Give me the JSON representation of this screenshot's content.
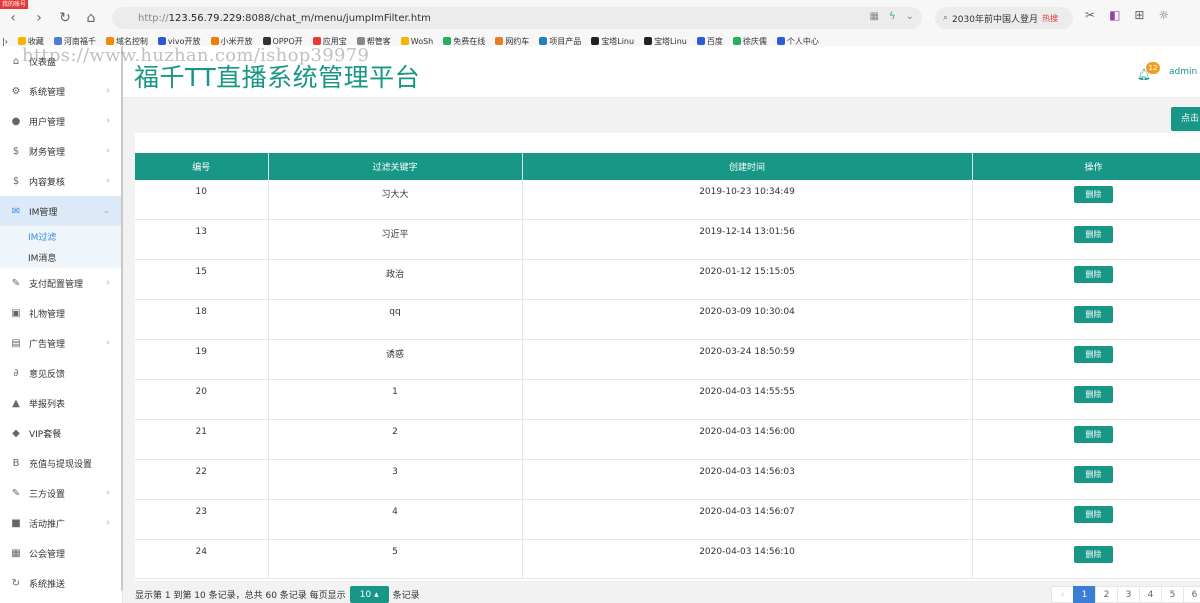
{
  "browser": {
    "badge": "我的账号",
    "protocol": "http://",
    "host": "123.56.79.229",
    "path": ":8088/chat_m/menu/jumpImFilter.htm",
    "search_text": "2030年前中国人登月",
    "search_hot": "热搜",
    "bookmarks": [
      {
        "label": "收藏",
        "color": "#f5b400"
      },
      {
        "label": "河南福千",
        "color": "#4a7fd0"
      },
      {
        "label": "域名控制",
        "color": "#f08c00"
      },
      {
        "label": "vivo开放",
        "color": "#2a5bd7"
      },
      {
        "label": "小米开放",
        "color": "#f57c00"
      },
      {
        "label": "OPPO开",
        "color": "#333333"
      },
      {
        "label": "应用宝",
        "color": "#e53935"
      },
      {
        "label": "帮管客",
        "color": "#888888"
      },
      {
        "label": "WoSh",
        "color": "#f5b400"
      },
      {
        "label": "免费在线",
        "color": "#27ae60"
      },
      {
        "label": "网约车",
        "color": "#e67e22"
      },
      {
        "label": "项目产品",
        "color": "#2980b9"
      },
      {
        "label": "宝塔Linu",
        "color": "#222222"
      },
      {
        "label": "宝塔Linu",
        "color": "#222222"
      },
      {
        "label": "百度",
        "color": "#2c5bd7"
      },
      {
        "label": "徐庆儒",
        "color": "#27ae60"
      },
      {
        "label": "个人中心",
        "color": "#2c5bd7"
      }
    ]
  },
  "watermark": "https://www.huzhan.com/ishop39979",
  "header": {
    "title": "福千TT直播系统管理平台",
    "notification_count": "12",
    "user": "admin"
  },
  "sidebar": {
    "items": [
      {
        "label": "仪表盘",
        "icon": "home-icon",
        "glyph": "⌂",
        "arrow": false
      },
      {
        "label": "系统管理",
        "icon": "settings-icon",
        "glyph": "⚙",
        "arrow": true
      },
      {
        "label": "用户管理",
        "icon": "user-icon",
        "glyph": "●",
        "arrow": true
      },
      {
        "label": "财务管理",
        "icon": "dollar-icon",
        "glyph": "$",
        "arrow": true
      },
      {
        "label": "内容复核",
        "icon": "dollar-icon",
        "glyph": "$",
        "arrow": true
      },
      {
        "label": "IM管理",
        "icon": "mail-icon",
        "glyph": "✉",
        "arrow": true,
        "active": true,
        "children": [
          {
            "label": "IM过滤",
            "current": true
          },
          {
            "label": "IM消息"
          }
        ]
      },
      {
        "label": "支付配置管理",
        "icon": "wrench-icon",
        "glyph": "✎",
        "arrow": true
      },
      {
        "label": "礼物管理",
        "icon": "gift-icon",
        "glyph": "▣",
        "arrow": false
      },
      {
        "label": "广告管理",
        "icon": "ad-icon",
        "glyph": "▤",
        "arrow": true
      },
      {
        "label": "意见反馈",
        "icon": "paperclip-icon",
        "glyph": "∂",
        "arrow": false
      },
      {
        "label": "举报列表",
        "icon": "warning-icon",
        "glyph": "▲",
        "arrow": false
      },
      {
        "label": "VIP套餐",
        "icon": "diamond-icon",
        "glyph": "◆",
        "arrow": false
      },
      {
        "label": "充值与提现设置",
        "icon": "bitcoin-icon",
        "glyph": "B",
        "arrow": false
      },
      {
        "label": "三方设置",
        "icon": "wrench-icon",
        "glyph": "✎",
        "arrow": true
      },
      {
        "label": "活动推广",
        "icon": "briefcase-icon",
        "glyph": "■",
        "arrow": true
      },
      {
        "label": "公会管理",
        "icon": "group-icon",
        "glyph": "▦",
        "arrow": false
      },
      {
        "label": "系统推送",
        "icon": "refresh-icon",
        "glyph": "↻",
        "arrow": false
      }
    ]
  },
  "toolbar": {
    "action_label": "点击"
  },
  "table": {
    "columns": [
      "编号",
      "过滤关键字",
      "创建时间",
      "操作"
    ],
    "delete_label": "删除",
    "rows": [
      {
        "id": "10",
        "keyword": "习大大",
        "created": "2019-10-23 10:34:49"
      },
      {
        "id": "13",
        "keyword": "习近平",
        "created": "2019-12-14 13:01:56"
      },
      {
        "id": "15",
        "keyword": "政治",
        "created": "2020-01-12 15:15:05"
      },
      {
        "id": "18",
        "keyword": "qq",
        "created": "2020-03-09 10:30:04"
      },
      {
        "id": "19",
        "keyword": "诱惑",
        "created": "2020-03-24 18:50:59"
      },
      {
        "id": "20",
        "keyword": "1",
        "created": "2020-04-03 14:55:55"
      },
      {
        "id": "21",
        "keyword": "2",
        "created": "2020-04-03 14:56:00"
      },
      {
        "id": "22",
        "keyword": "3",
        "created": "2020-04-03 14:56:03"
      },
      {
        "id": "23",
        "keyword": "4",
        "created": "2020-04-03 14:56:07"
      },
      {
        "id": "24",
        "keyword": "5",
        "created": "2020-04-03 14:56:10"
      }
    ]
  },
  "footer": {
    "info_text": "显示第 1 到第 10 条记录，总共 60 条记录 每页显示",
    "page_size": "10 ▴",
    "suffix": "条记录",
    "pages": [
      "‹",
      "1",
      "2",
      "3",
      "4",
      "5",
      "6"
    ],
    "current_page": "1"
  },
  "colors": {
    "accent": "#189686",
    "active_sub": "#3a8ee6",
    "pager_current": "#3a7fd5"
  }
}
